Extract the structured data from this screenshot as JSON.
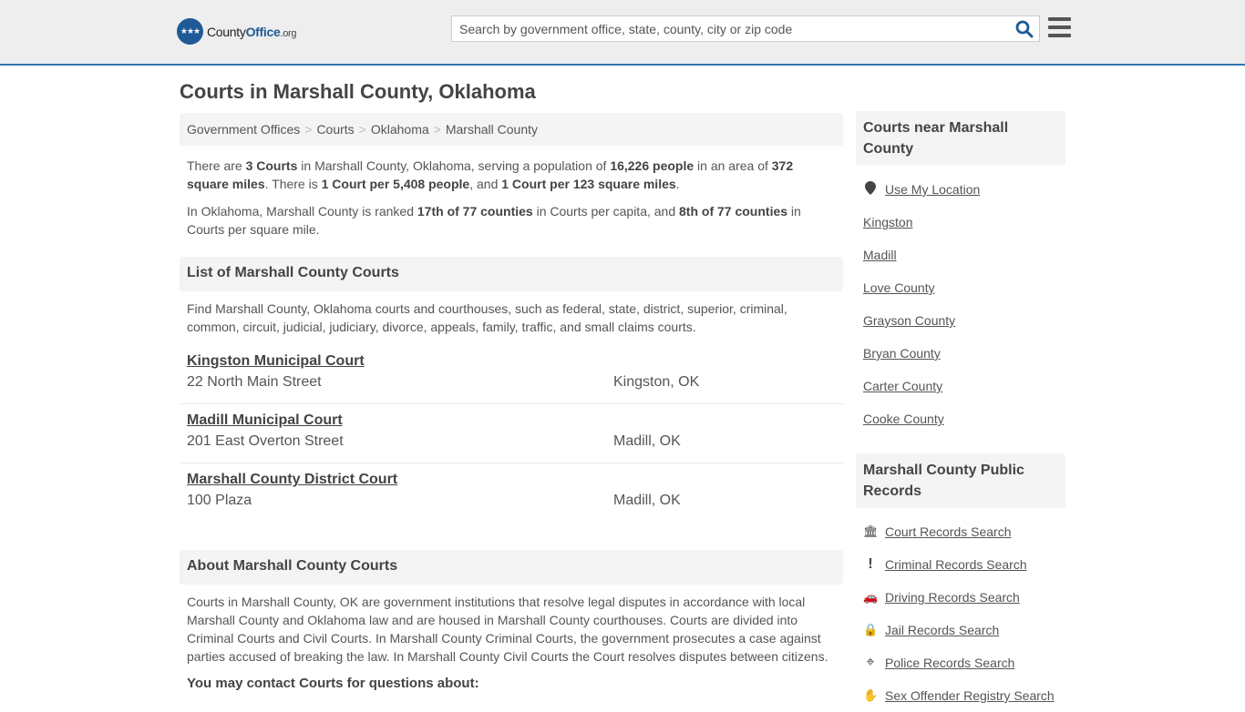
{
  "header": {
    "logo_text_main": "County",
    "logo_text_brand": "Office",
    "logo_text_tld": ".org",
    "search_placeholder": "Search by government office, state, county, city or zip code",
    "search_value": "",
    "search_icon": "search-icon",
    "menu_icon": "hamburger-menu-icon",
    "accent_color": "#3274ad"
  },
  "page_title": "Courts in Marshall County, Oklahoma",
  "breadcrumb": [
    "Government Offices",
    "Courts",
    "Oklahoma",
    "Marshall County"
  ],
  "breadcrumb_separator": ">",
  "summary": {
    "p1": [
      {
        "t": "There are ",
        "b": false
      },
      {
        "t": "3 Courts",
        "b": true
      },
      {
        "t": " in Marshall County, Oklahoma, serving a population of ",
        "b": false
      },
      {
        "t": "16,226 people",
        "b": true
      },
      {
        "t": " in an area of ",
        "b": false
      },
      {
        "t": "372 square miles",
        "b": true
      },
      {
        "t": ". There is ",
        "b": false
      },
      {
        "t": "1 Court per 5,408 people",
        "b": true
      },
      {
        "t": ", and ",
        "b": false
      },
      {
        "t": "1 Court per 123 square miles",
        "b": true
      },
      {
        "t": ".",
        "b": false
      }
    ],
    "p2": [
      {
        "t": "In Oklahoma, Marshall County is ranked ",
        "b": false
      },
      {
        "t": "17th of 77 counties",
        "b": true
      },
      {
        "t": " in Courts per capita, and ",
        "b": false
      },
      {
        "t": "8th of 77 counties",
        "b": true
      },
      {
        "t": " in Courts per square mile.",
        "b": false
      }
    ]
  },
  "list_section": {
    "heading": "List of Marshall County Courts",
    "intro": "Find Marshall County, Oklahoma courts and courthouses, such as federal, state, district, superior, criminal, common, circuit, judicial, judiciary, divorce, appeals, family, traffic, and small claims courts.",
    "courts": [
      {
        "name": "Kingston Municipal Court",
        "address": "22 North Main Street",
        "city": "Kingston, OK"
      },
      {
        "name": "Madill Municipal Court",
        "address": "201 East Overton Street",
        "city": "Madill, OK"
      },
      {
        "name": "Marshall County District Court",
        "address": "100 Plaza",
        "city": "Madill, OK"
      }
    ]
  },
  "about_section": {
    "heading": "About Marshall County Courts",
    "body": "Courts in Marshall County, OK are government institutions that resolve legal disputes in accordance with local Marshall County and Oklahoma law and are housed in Marshall County courthouses. Courts are divided into Criminal Courts and Civil Courts. In Marshall County Criminal Courts, the government prosecutes a case against parties accused of breaking the law. In Marshall County Civil Courts the Court resolves disputes between citizens.",
    "contact_heading": "You may contact Courts for questions about:"
  },
  "sidebar": {
    "nearby_heading": "Courts near Marshall County",
    "nearby": [
      {
        "label": "Use My Location",
        "icon": "map-marker-icon"
      },
      {
        "label": "Kingston"
      },
      {
        "label": "Madill"
      },
      {
        "label": "Love County"
      },
      {
        "label": "Grayson County"
      },
      {
        "label": "Bryan County"
      },
      {
        "label": "Carter County"
      },
      {
        "label": "Cooke County"
      }
    ],
    "records_heading": "Marshall County Public Records",
    "records": [
      {
        "label": "Court Records Search",
        "icon": "courthouse-icon",
        "glyph": "🏛"
      },
      {
        "label": "Criminal Records Search",
        "icon": "exclamation-icon",
        "glyph": "!"
      },
      {
        "label": "Driving Records Search",
        "icon": "car-icon",
        "glyph": "🚗"
      },
      {
        "label": "Jail Records Search",
        "icon": "lock-icon",
        "glyph": "🔒"
      },
      {
        "label": "Police Records Search",
        "icon": "crosshairs-icon",
        "glyph": "⌖"
      },
      {
        "label": "Sex Offender Registry Search",
        "icon": "hand-icon",
        "glyph": "✋"
      }
    ]
  }
}
